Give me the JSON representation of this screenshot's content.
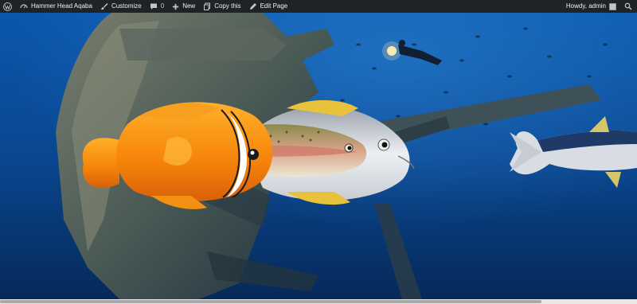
{
  "adminbar": {
    "wp_logo_icon": "wordpress-icon",
    "site_name": "Hammer Head Aqaba",
    "customize_label": "Customize",
    "comments_count": "0",
    "new_label": "New",
    "copy_label": "Copy this",
    "edit_label": "Edit Page",
    "greeting": "Howdy, admin",
    "colors": {
      "bar": "#1d2327",
      "text": "#f0f0f1"
    }
  },
  "hero": {
    "description_icons": [
      "shipwreck-illustration",
      "clownfish-illustration",
      "trout-illustration",
      "trevally-illustration",
      "tuna-illustration",
      "diver-illustration"
    ],
    "colors": {
      "water_top": "#0a4fa0",
      "water_bottom": "#062a5a",
      "clownfish": "#f58a0c"
    }
  },
  "scrollbar": {
    "thumb_fraction": 0.85
  }
}
